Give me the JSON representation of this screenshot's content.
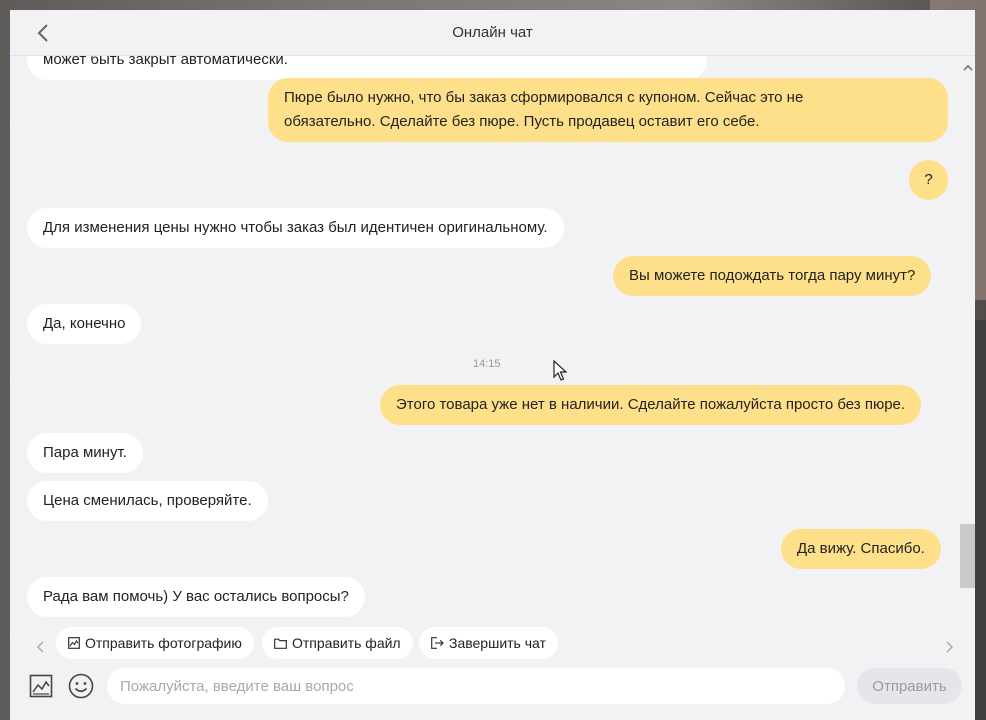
{
  "header": {
    "title": "Онлайн чат"
  },
  "messages": [
    {
      "side": "in",
      "text": "может быть закрыт автоматически."
    },
    {
      "side": "out",
      "lines": [
        "Пюре было нужно, что бы заказ сформировался с купоном. Сейчас это не",
        "обязательно. Сделайте без пюре. Пусть продавец оставит его себе."
      ]
    },
    {
      "side": "out",
      "text": "?"
    },
    {
      "side": "in",
      "text": "Для изменения цены нужно чтобы заказ был идентичен оригинальному."
    },
    {
      "side": "out",
      "text": "Вы можете подождать тогда пару минут?"
    },
    {
      "side": "in",
      "text": "Да, конечно"
    },
    {
      "side": "time",
      "text": "14:15"
    },
    {
      "side": "out",
      "text": "Этого товара уже нет в наличии. Сделайте пожалуйста просто без пюре."
    },
    {
      "side": "in",
      "text": "Пара минут."
    },
    {
      "side": "in",
      "text": "Цена сменилась, проверяйте."
    },
    {
      "side": "out",
      "text": "Да вижу. Спасибо."
    },
    {
      "side": "in",
      "text": "Рада вам помочь) У вас остались вопросы?"
    }
  ],
  "quick_actions": {
    "send_photo": "Отправить фотографию",
    "send_file": "Отправить файл",
    "end_chat": "Завершить чат"
  },
  "composer": {
    "placeholder": "Пожалуйста, введите ваш вопрос",
    "send_label": "Отправить"
  },
  "icons": {
    "back": "chevron-left-icon",
    "scroll_up": "chevron-up-icon",
    "photo": "image-icon",
    "file": "folder-icon",
    "end": "exit-icon",
    "attach_image": "image-icon",
    "emoji": "smiley-icon"
  },
  "colors": {
    "incoming_bubble": "#ffffff",
    "outgoing_bubble": "#ffe08a",
    "background": "#f2f2f5"
  }
}
